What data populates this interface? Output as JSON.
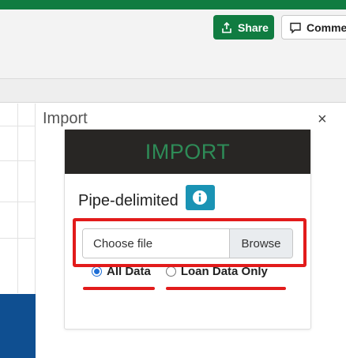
{
  "toolbar": {
    "share_label": "Share",
    "comment_label": "Comments",
    "accent": "#107c41"
  },
  "pane": {
    "title": "Import",
    "close_icon": "close-icon"
  },
  "card": {
    "header": "IMPORT",
    "header_color": "#2e8b57",
    "heading": "Pipe-delimited",
    "info_icon": "info-icon",
    "file_placeholder": "Choose file",
    "browse_label": "Browse",
    "options": [
      {
        "label": "All Data",
        "selected": true
      },
      {
        "label": "Loan Data Only",
        "selected": false
      }
    ]
  },
  "annotation_color": "#e21b1b"
}
